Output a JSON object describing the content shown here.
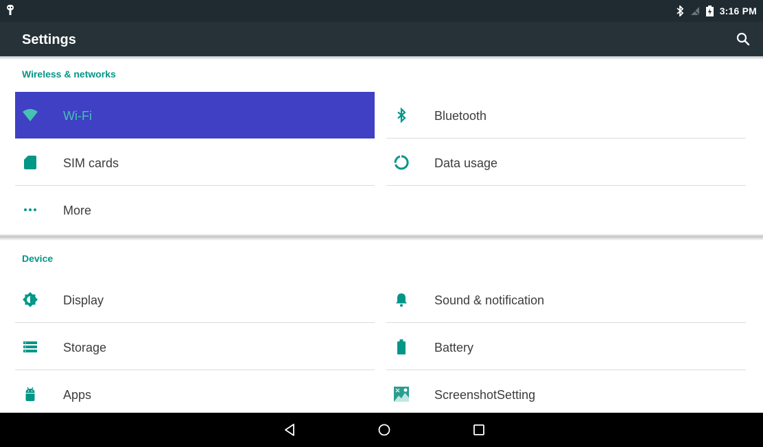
{
  "status_bar": {
    "time": "3:16 PM"
  },
  "app_bar": {
    "title": "Settings"
  },
  "sections": [
    {
      "header": "Wireless & networks",
      "items": [
        {
          "label": "Wi-Fi",
          "icon": "wifi-icon",
          "selected": true
        },
        {
          "label": "Bluetooth",
          "icon": "bluetooth-icon"
        },
        {
          "label": "SIM cards",
          "icon": "sim-card-icon"
        },
        {
          "label": "Data usage",
          "icon": "data-usage-icon"
        },
        {
          "label": "More",
          "icon": "more-dots-icon"
        }
      ]
    },
    {
      "header": "Device",
      "items": [
        {
          "label": "Display",
          "icon": "display-brightness-icon"
        },
        {
          "label": "Sound & notification",
          "icon": "bell-icon"
        },
        {
          "label": "Storage",
          "icon": "storage-icon"
        },
        {
          "label": "Battery",
          "icon": "battery-icon"
        },
        {
          "label": "Apps",
          "icon": "android-icon"
        },
        {
          "label": "ScreenshotSetting",
          "icon": "screenshot-icon"
        }
      ]
    }
  ],
  "colors": {
    "accent": "#009688",
    "highlight": "#3f40c3",
    "app_bar": "#263238",
    "status_bar": "#1f2b30"
  }
}
